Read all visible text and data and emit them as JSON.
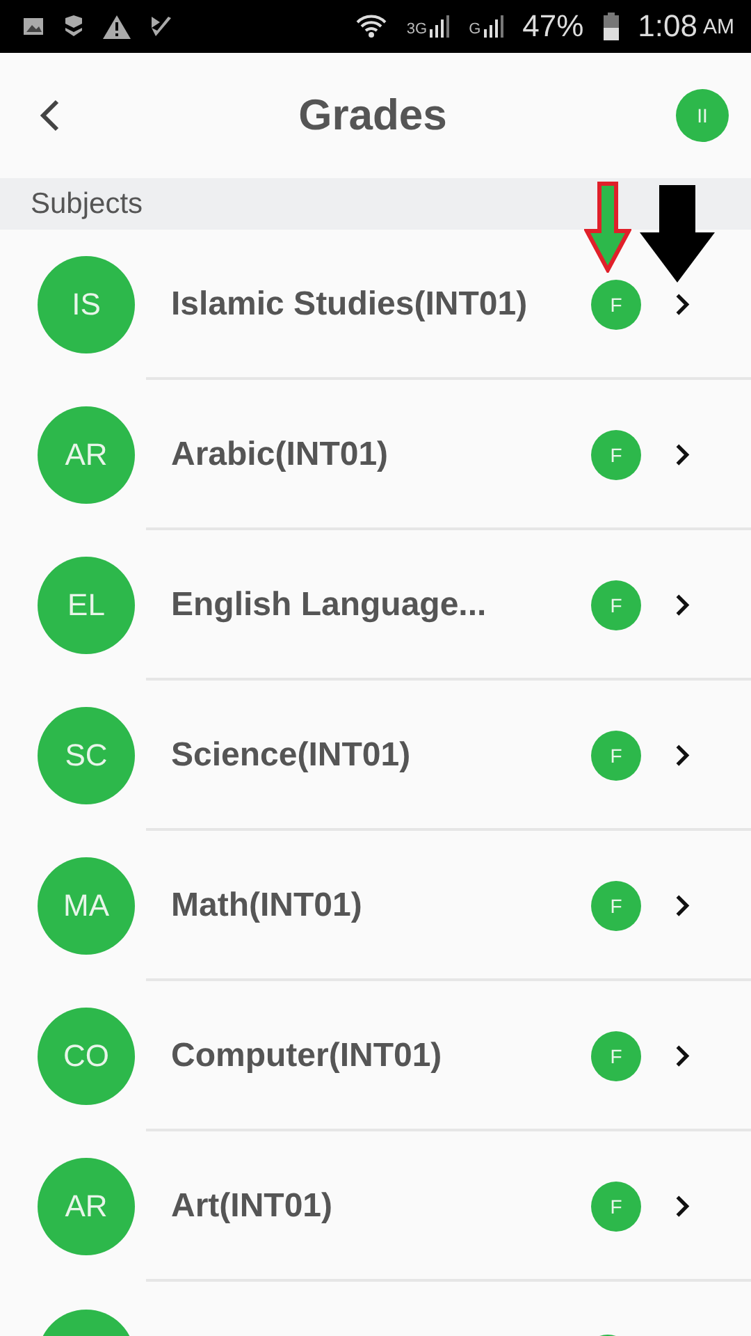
{
  "status_bar": {
    "network": "3G",
    "network_2": "G",
    "battery": "47%",
    "time": "1:08",
    "meridiem": "AM"
  },
  "header": {
    "title": "Grades",
    "avatar": "II"
  },
  "section": {
    "title": "Subjects"
  },
  "subjects": [
    {
      "initials": "IS",
      "name": "Islamic Studies(INT01)",
      "grade": "F"
    },
    {
      "initials": "AR",
      "name": "Arabic(INT01)",
      "grade": "F"
    },
    {
      "initials": "EL",
      "name": "English Language...",
      "grade": "F"
    },
    {
      "initials": "SC",
      "name": "Science(INT01)",
      "grade": "F"
    },
    {
      "initials": "MA",
      "name": "Math(INT01)",
      "grade": "F"
    },
    {
      "initials": "CO",
      "name": "Computer(INT01)",
      "grade": "F"
    },
    {
      "initials": "AR",
      "name": "Art(INT01)",
      "grade": "F"
    },
    {
      "kind": "cut_off"
    }
  ],
  "annotations": [
    {
      "kind": "outlined"
    },
    {
      "kind": "solid"
    }
  ]
}
